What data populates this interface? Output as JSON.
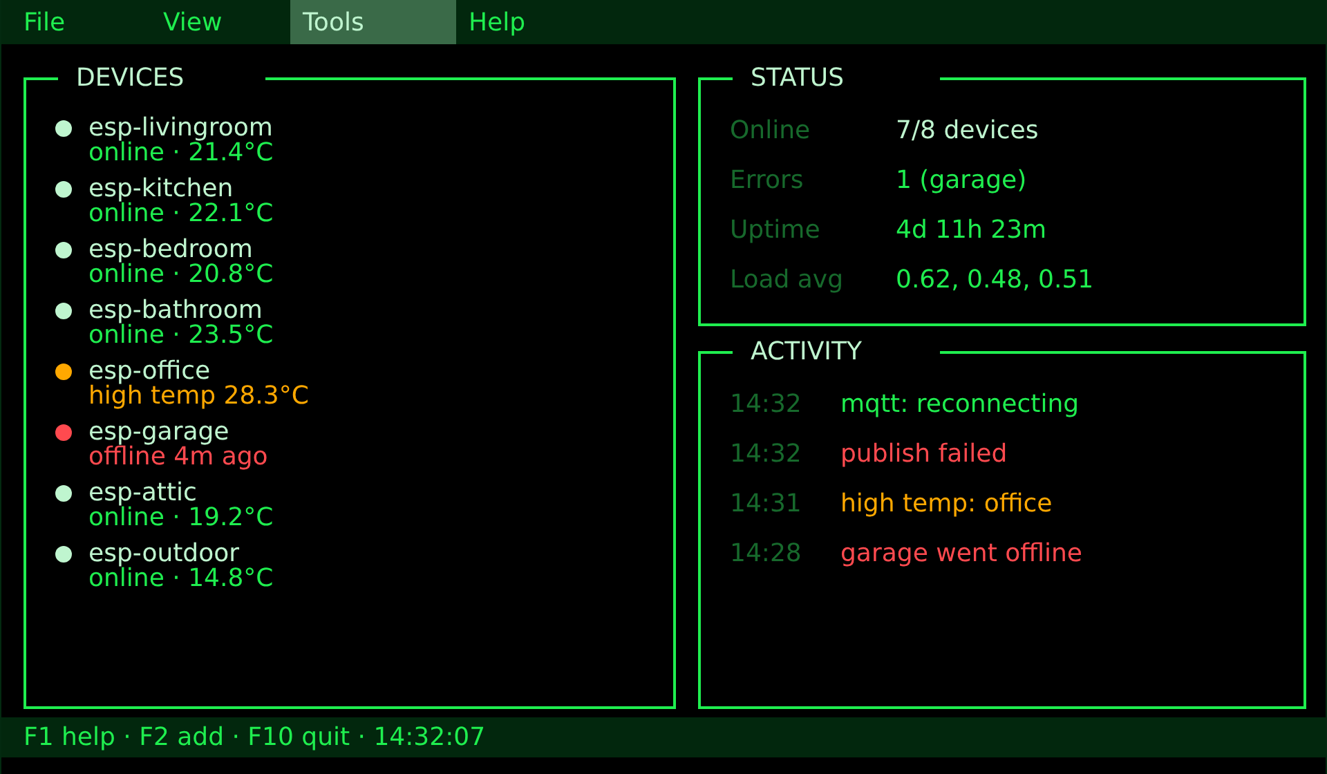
{
  "menu": [
    {
      "label": "File",
      "selected": false
    },
    {
      "label": "View",
      "selected": false
    },
    {
      "label": "Tools",
      "selected": true
    },
    {
      "label": "Help",
      "selected": false
    }
  ],
  "devices": {
    "title": "DEVICES",
    "items": [
      {
        "name": "esp-livingroom",
        "status": "online · 21.4°C",
        "kind": "ok"
      },
      {
        "name": "esp-kitchen",
        "status": "online · 22.1°C",
        "kind": "ok"
      },
      {
        "name": "esp-bedroom",
        "status": "online · 20.8°C",
        "kind": "ok"
      },
      {
        "name": "esp-bathroom",
        "status": "online · 23.5°C",
        "kind": "ok"
      },
      {
        "name": "esp-office",
        "status": "high temp 28.3°C",
        "kind": "warning"
      },
      {
        "name": "esp-garage",
        "status": "offline 4m ago",
        "kind": "error"
      },
      {
        "name": "esp-attic",
        "status": "online · 19.2°C",
        "kind": "ok"
      },
      {
        "name": "esp-outdoor",
        "status": "online · 14.8°C",
        "kind": "ok"
      }
    ]
  },
  "status": {
    "title": "STATUS",
    "rows": [
      {
        "label": "Online",
        "value": "7/8 devices",
        "emphasis": true
      },
      {
        "label": "Errors",
        "value": "1 (garage)",
        "emphasis": false
      },
      {
        "label": "Uptime",
        "value": "4d 11h 23m",
        "emphasis": false
      },
      {
        "label": "Load avg",
        "value": "0.62, 0.48, 0.51",
        "emphasis": false
      }
    ]
  },
  "activity": {
    "title": "ACTIVITY",
    "entries": [
      {
        "time": "14:32",
        "message": "mqtt: reconnecting",
        "kind": "info"
      },
      {
        "time": "14:32",
        "message": "publish failed",
        "kind": "error"
      },
      {
        "time": "14:31",
        "message": "high temp: office",
        "kind": "warning"
      },
      {
        "time": "14:28",
        "message": "garage went offline",
        "kind": "error"
      }
    ]
  },
  "status_bar": "F1 help · F2 add · F10 quit · 14:32:07"
}
